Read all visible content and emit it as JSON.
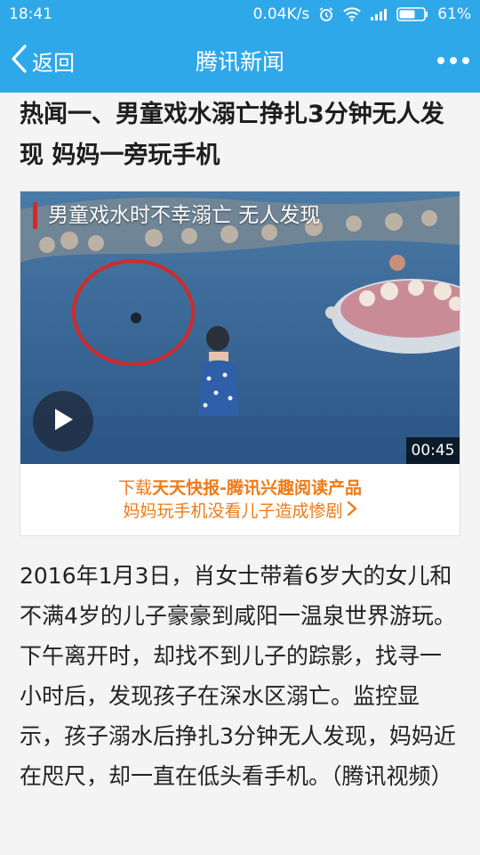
{
  "status_bar": {
    "time": "18:41",
    "network_speed": "0.04K/s",
    "battery_percent": "61%",
    "icons": [
      "alarm-icon",
      "wifi-icon",
      "signal-icon",
      "battery-icon"
    ]
  },
  "nav": {
    "back_label": "返回",
    "title": "腾讯新闻",
    "more_icon": "more-dots-icon"
  },
  "article": {
    "headline": "热闻一、男童戏水溺亡挣扎3分钟无人发现 妈妈一旁玩手机",
    "video": {
      "caption": "男童戏水时不幸溺亡 无人发现",
      "duration": "00:45",
      "play_icon": "play-icon"
    },
    "promo": {
      "prefix": "下载",
      "brand": "天天快报-腾讯兴趣阅读产品",
      "subtitle": "妈妈玩手机没看儿子造成惨剧"
    },
    "body": "2016年1月3日，肖女士带着6岁大的女儿和不满4岁的儿子豪豪到咸阳一温泉世界游玩。下午离开时，却找不到儿子的踪影，找寻一小时后，发现孩子在深水区溺亡。监控显示，孩子溺水后挣扎3分钟无人发现，妈妈近在咫尺，却一直在低头看手机。（腾讯视频）"
  },
  "colors": {
    "brand_blue": "#2fa8ea",
    "promo_orange": "#f07a16",
    "caption_bar_red": "#d12a2a"
  }
}
